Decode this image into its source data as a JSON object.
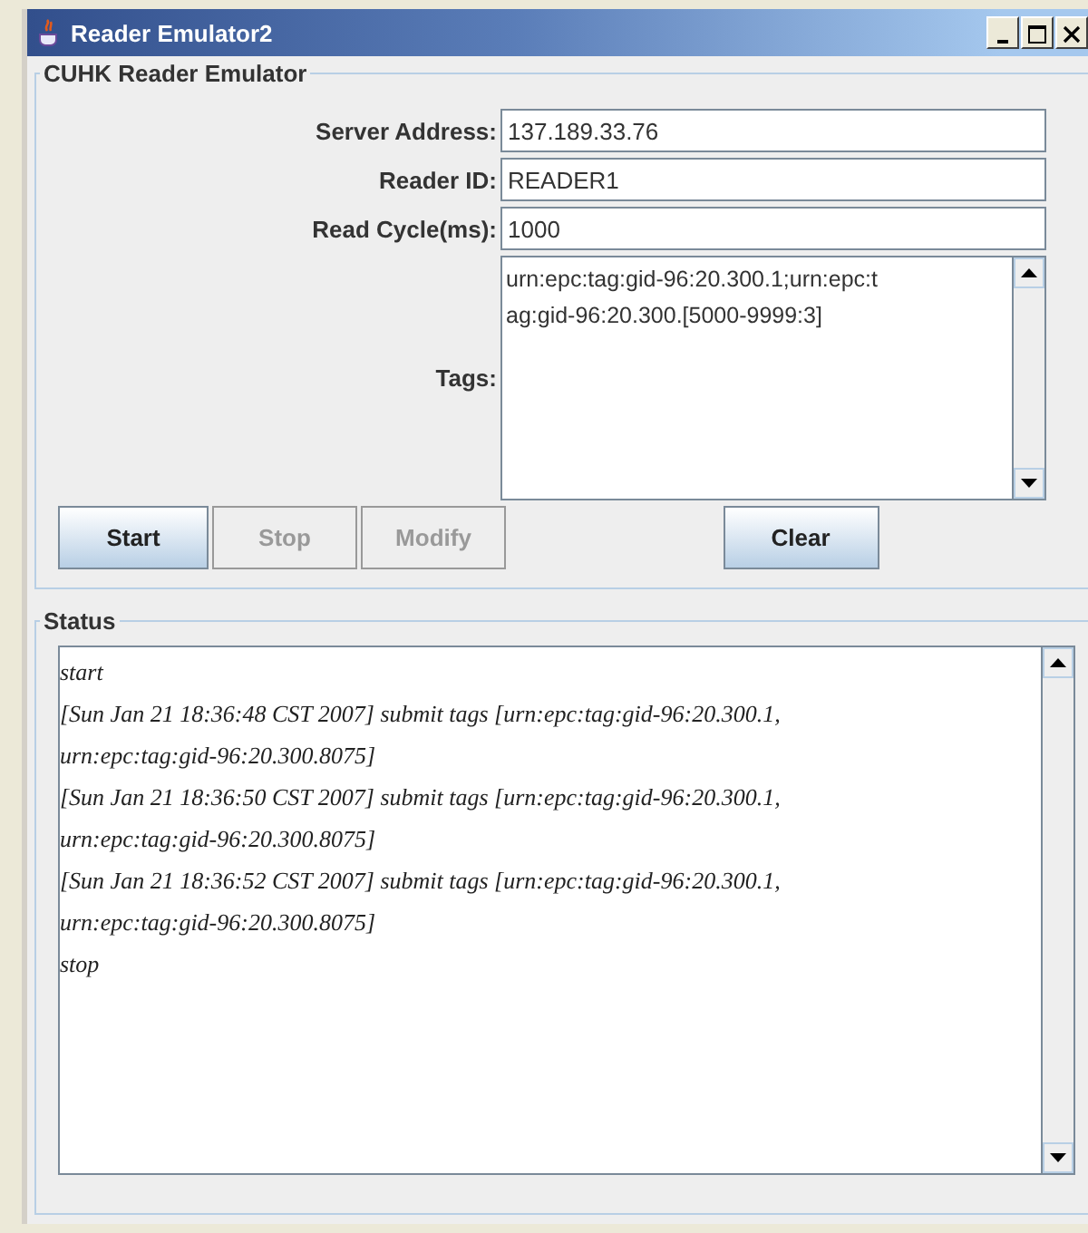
{
  "window": {
    "title": "Reader Emulator2"
  },
  "reader_group": {
    "title": "CUHK Reader Emulator",
    "fields": [
      {
        "label": "Server Address:",
        "value": "137.189.33.76"
      },
      {
        "label": "Reader ID:",
        "value": "READER1"
      },
      {
        "label": "Read Cycle(ms):",
        "value": "1000"
      }
    ],
    "tags": {
      "label": "Tags:",
      "lines": [
        "urn:epc:tag:gid-96:20.300.1;urn:epc:t",
        "ag:gid-96:20.300.[5000-9999:3]"
      ]
    },
    "buttons": [
      {
        "label": "Start",
        "disabled": false
      },
      {
        "label": "Stop",
        "disabled": true
      },
      {
        "label": "Modify",
        "disabled": true
      }
    ],
    "clear_button": {
      "label": "Clear",
      "disabled": false
    }
  },
  "status_group": {
    "title": "Status",
    "lines": [
      "start",
      "[Sun Jan 21 18:36:48 CST 2007] submit tags [urn:epc:tag:gid-96:20.300.1,",
      "urn:epc:tag:gid-96:20.300.8075]",
      "[Sun Jan 21 18:36:50 CST 2007] submit tags [urn:epc:tag:gid-96:20.300.1,",
      "urn:epc:tag:gid-96:20.300.8075]",
      "[Sun Jan 21 18:36:52 CST 2007] submit tags [urn:epc:tag:gid-96:20.300.1,",
      "urn:epc:tag:gid-96:20.300.8075]",
      "stop"
    ]
  }
}
